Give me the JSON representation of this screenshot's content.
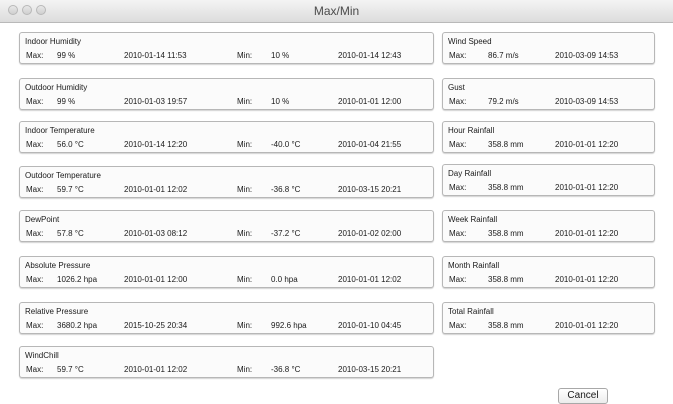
{
  "window": {
    "title": "Max/Min"
  },
  "left_groups": [
    {
      "title": "Indoor Humidity",
      "max_label": "Max:",
      "max_value": "99 %",
      "max_time": "2010-01-14 11:53",
      "min_label": "Min:",
      "min_value": "10 %",
      "min_time": "2010-01-14 12:43"
    },
    {
      "title": "Outdoor Humidity",
      "max_label": "Max:",
      "max_value": "99 %",
      "max_time": "2010-01-03 19:57",
      "min_label": "Min:",
      "min_value": "10 %",
      "min_time": "2010-01-01 12:00"
    },
    {
      "title": "Indoor Temperature",
      "max_label": "Max:",
      "max_value": "56.0 °C",
      "max_time": "2010-01-14 12:20",
      "min_label": "Min:",
      "min_value": "-40.0 °C",
      "min_time": "2010-01-04 21:55"
    },
    {
      "title": "Outdoor Temperature",
      "max_label": "Max:",
      "max_value": "59.7 °C",
      "max_time": "2010-01-01 12:02",
      "min_label": "Min:",
      "min_value": "-36.8 °C",
      "min_time": "2010-03-15 20:21"
    },
    {
      "title": "DewPoint",
      "max_label": "Max:",
      "max_value": "57.8 °C",
      "max_time": "2010-01-03 08:12",
      "min_label": "Min:",
      "min_value": "-37.2 °C",
      "min_time": "2010-01-02 02:00"
    },
    {
      "title": "Absolute Pressure",
      "max_label": "Max:",
      "max_value": "1026.2 hpa",
      "max_time": "2010-01-01 12:00",
      "min_label": "Min:",
      "min_value": "0.0 hpa",
      "min_time": "2010-01-01 12:02"
    },
    {
      "title": "Relative Pressure",
      "max_label": "Max:",
      "max_value": "3680.2 hpa",
      "max_time": "2015-10-25 20:34",
      "min_label": "Min:",
      "min_value": "992.6 hpa",
      "min_time": "2010-01-10 04:45"
    },
    {
      "title": "WindChill",
      "max_label": "Max:",
      "max_value": "59.7 °C",
      "max_time": "2010-01-01 12:02",
      "min_label": "Min:",
      "min_value": "-36.8 °C",
      "min_time": "2010-03-15 20:21"
    }
  ],
  "right_groups": [
    {
      "title": "Wind Speed",
      "max_label": "Max:",
      "max_value": "86.7 m/s",
      "max_time": "2010-03-09 14:53"
    },
    {
      "title": "Gust",
      "max_label": "Max:",
      "max_value": "79.2 m/s",
      "max_time": "2010-03-09 14:53"
    },
    {
      "title": "Hour Rainfall",
      "max_label": "Max:",
      "max_value": "358.8 mm",
      "max_time": "2010-01-01 12:20"
    },
    {
      "title": "Day Rainfall",
      "max_label": "Max:",
      "max_value": "358.8 mm",
      "max_time": "2010-01-01 12:20"
    },
    {
      "title": "Week Rainfall",
      "max_label": "Max:",
      "max_value": "358.8 mm",
      "max_time": "2010-01-01 12:20"
    },
    {
      "title": "Month Rainfall",
      "max_label": "Max:",
      "max_value": "358.8 mm",
      "max_time": "2010-01-01 12:20"
    },
    {
      "title": "Total Rainfall",
      "max_label": "Max:",
      "max_value": "358.8 mm",
      "max_time": "2010-01-01 12:20"
    }
  ],
  "buttons": {
    "cancel": "Cancel"
  }
}
